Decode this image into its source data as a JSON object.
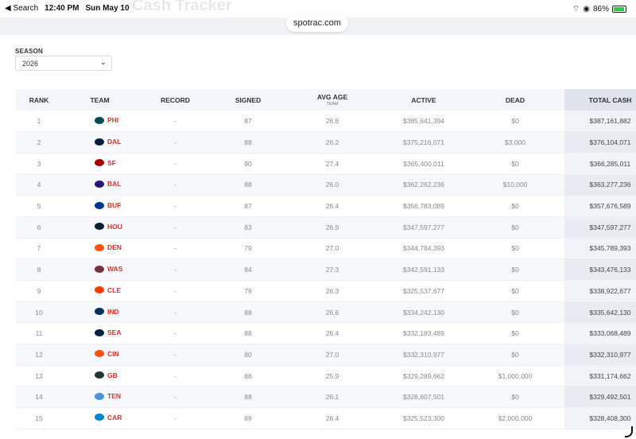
{
  "statusbar": {
    "back_label": "◀ Search",
    "time": "12:40 PM",
    "date": "Sun May 10",
    "battery": "86%"
  },
  "browser": {
    "url": "spotrac.com"
  },
  "page": {
    "title": "Cash Tracker"
  },
  "filter": {
    "season_label": "SEASON",
    "season_value": "2026"
  },
  "table": {
    "headers": {
      "rank": "RANK",
      "team": "TEAM",
      "record": "RECORD",
      "signed": "SIGNED",
      "avg_age": "AVG AGE",
      "avg_age_sub": "TEAM",
      "active": "ACTIVE",
      "dead": "DEAD",
      "total": "TOTAL CASH"
    },
    "rows": [
      {
        "rank": "1",
        "team": "PHI",
        "color": "#004c54",
        "record": "-",
        "signed": "87",
        "age": "26.6",
        "active": "$385,641,394",
        "dead": "$0",
        "total": "$387,161,882"
      },
      {
        "rank": "2",
        "team": "DAL",
        "color": "#041e42",
        "record": "-",
        "signed": "88",
        "age": "26.2",
        "active": "$375,216,071",
        "dead": "$3,000",
        "total": "$376,104,071"
      },
      {
        "rank": "3",
        "team": "SF",
        "color": "#aa0000",
        "record": "-",
        "signed": "90",
        "age": "27.4",
        "active": "$365,400,011",
        "dead": "$0",
        "total": "$366,285,011"
      },
      {
        "rank": "4",
        "team": "BAL",
        "color": "#241773",
        "record": "-",
        "signed": "88",
        "age": "26.0",
        "active": "$362,262,236",
        "dead": "$10,000",
        "total": "$363,277,236"
      },
      {
        "rank": "5",
        "team": "BUF",
        "color": "#00338d",
        "record": "-",
        "signed": "87",
        "age": "26.4",
        "active": "$356,783,089",
        "dead": "$0",
        "total": "$357,676,589"
      },
      {
        "rank": "6",
        "team": "HOU",
        "color": "#03202f",
        "record": "-",
        "signed": "83",
        "age": "26.9",
        "active": "$347,597,277",
        "dead": "$0",
        "total": "$347,597,277"
      },
      {
        "rank": "7",
        "team": "DEN",
        "color": "#fb4f14",
        "record": "-",
        "signed": "79",
        "age": "27.0",
        "active": "$344,784,393",
        "dead": "$0",
        "total": "$345,789,393"
      },
      {
        "rank": "8",
        "team": "WAS",
        "color": "#773141",
        "record": "-",
        "signed": "84",
        "age": "27.3",
        "active": "$342,591,133",
        "dead": "$0",
        "total": "$343,476,133"
      },
      {
        "rank": "9",
        "team": "CLE",
        "color": "#ff3c00",
        "record": "-",
        "signed": "79",
        "age": "26.3",
        "active": "$325,537,677",
        "dead": "$0",
        "total": "$338,922,677"
      },
      {
        "rank": "10",
        "team": "IND",
        "color": "#002c5f",
        "record": "-",
        "signed": "88",
        "age": "26.6",
        "active": "$334,242,130",
        "dead": "$0",
        "total": "$335,642,130"
      },
      {
        "rank": "11",
        "team": "SEA",
        "color": "#002244",
        "record": "-",
        "signed": "88",
        "age": "26.4",
        "active": "$332,183,489",
        "dead": "$0",
        "total": "$333,068,489"
      },
      {
        "rank": "12",
        "team": "CIN",
        "color": "#fb4f14",
        "record": "-",
        "signed": "80",
        "age": "27.0",
        "active": "$332,310,977",
        "dead": "$0",
        "total": "$332,310,977"
      },
      {
        "rank": "13",
        "team": "GB",
        "color": "#203731",
        "record": "-",
        "signed": "88",
        "age": "25.9",
        "active": "$329,289,662",
        "dead": "$1,000,000",
        "total": "$331,174,662"
      },
      {
        "rank": "14",
        "team": "TEN",
        "color": "#4b92db",
        "record": "-",
        "signed": "88",
        "age": "26.1",
        "active": "$328,607,501",
        "dead": "$0",
        "total": "$329,492,501"
      },
      {
        "rank": "15",
        "team": "CAR",
        "color": "#0085ca",
        "record": "-",
        "signed": "89",
        "age": "26.4",
        "active": "$325,523,300",
        "dead": "$2,000,000",
        "total": "$328,408,300"
      }
    ]
  }
}
